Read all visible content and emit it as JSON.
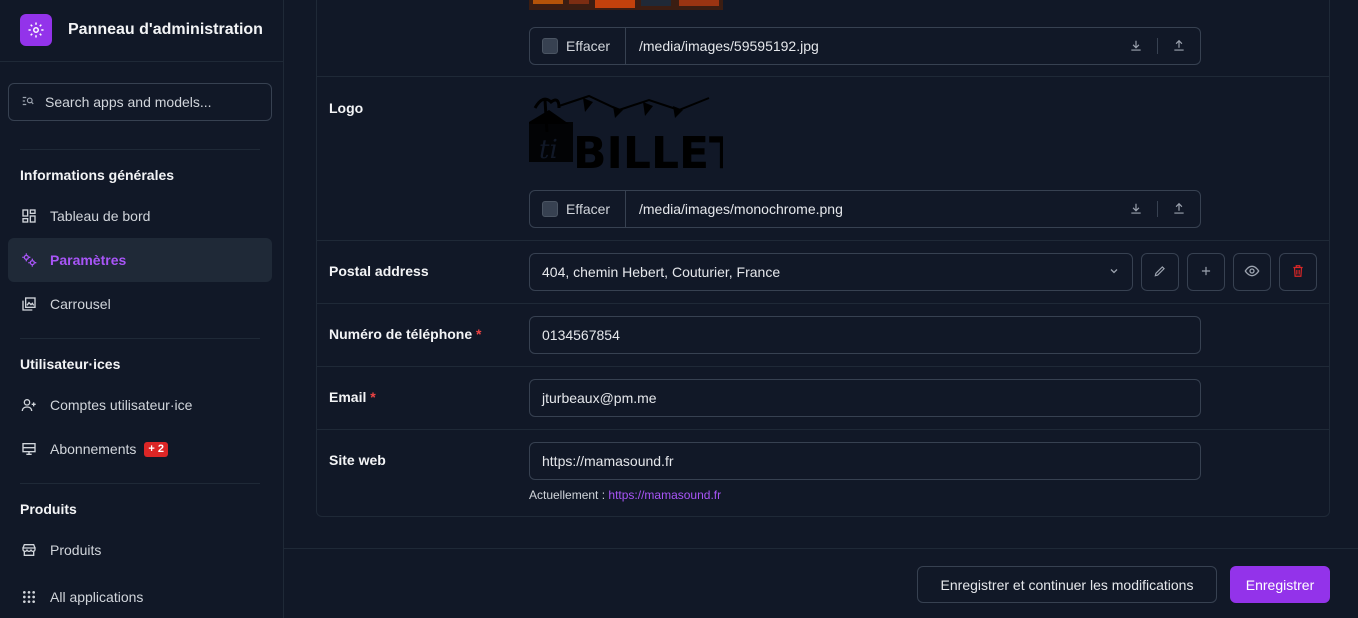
{
  "sidebar": {
    "brand_title": "Panneau d'administration",
    "search_placeholder": "Search apps and models...",
    "sections": [
      {
        "title": "Informations générales",
        "items": [
          {
            "label": "Tableau de bord",
            "icon": "dashboard-icon"
          },
          {
            "label": "Paramètres",
            "icon": "settings-icon",
            "active": true
          },
          {
            "label": "Carrousel",
            "icon": "gallery-icon"
          }
        ]
      },
      {
        "title": "Utilisateur·ices",
        "items": [
          {
            "label": "Comptes utilisateur·ice",
            "icon": "person-add-icon"
          },
          {
            "label": "Abonnements",
            "icon": "card-icon",
            "badge": "+ 2"
          }
        ]
      },
      {
        "title": "Produits",
        "items": [
          {
            "label": "Produits",
            "icon": "store-icon"
          },
          {
            "label": "All applications",
            "icon": "apps-grid-icon"
          }
        ]
      }
    ]
  },
  "form": {
    "image": {
      "clear_label": "Effacer",
      "path": "/media/images/59595192.jpg"
    },
    "logo": {
      "label": "Logo",
      "clear_label": "Effacer",
      "path": "/media/images/monochrome.png",
      "logo_text": "BILLET",
      "logo_script": "ti"
    },
    "postal_address": {
      "label": "Postal address",
      "value": "404, chemin Hebert, Couturier, France"
    },
    "phone": {
      "label": "Numéro de téléphone",
      "required": "*",
      "value": "0134567854"
    },
    "email": {
      "label": "Email",
      "required": "*",
      "value": "jturbeaux@pm.me"
    },
    "website": {
      "label": "Site web",
      "value": "https://mamasound.fr",
      "help_prefix": "Actuellement :",
      "help_link": "https://mamasound.fr"
    }
  },
  "footer": {
    "save_continue_label": "Enregistrer et continuer les modifications",
    "save_label": "Enregistrer"
  },
  "colors": {
    "accent": "#9333ea",
    "danger": "#dc2626",
    "background": "#111827"
  }
}
